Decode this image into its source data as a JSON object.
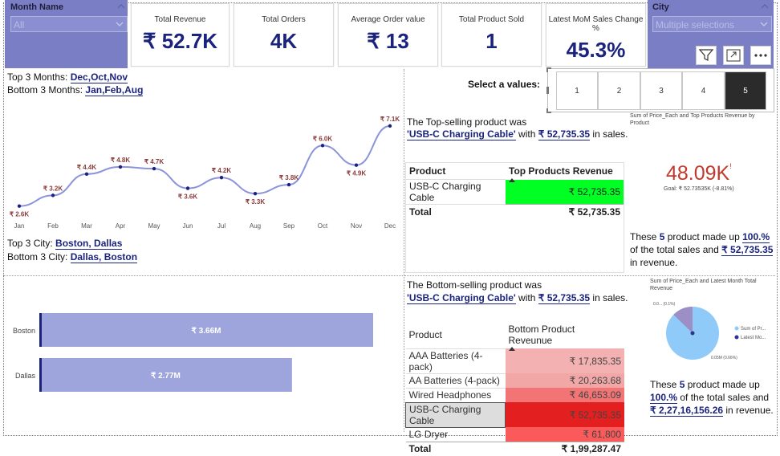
{
  "month_slicer": {
    "title": "Month Name",
    "value": "All"
  },
  "city_slicer": {
    "title": "City",
    "value": "Multiple selections"
  },
  "kpis": [
    {
      "label": "Total Revenue",
      "value": "₹ 52.7K"
    },
    {
      "label": "Total Orders",
      "value": "4K"
    },
    {
      "label": "Average Order value",
      "value": "₹ 13"
    },
    {
      "label": "Total Product Sold",
      "value": "1"
    },
    {
      "label": "Latest MoM Sales Change %",
      "value": "45.3%"
    }
  ],
  "months_text": {
    "top_prefix": "Top 3 Months: ",
    "top_value": "Dec,Oct,Nov",
    "bottom_prefix": "Bottom 3 Months: ",
    "bottom_value": "Jan,Feb,Aug"
  },
  "city_text": {
    "top_prefix": "Top 3 City:  ",
    "top_value": "Boston, Dallas",
    "bottom_prefix": "Bottom 3 City: ",
    "bottom_value": "Dallas, Boston"
  },
  "chart_data": [
    {
      "type": "line",
      "categories": [
        "Jan",
        "Feb",
        "Mar",
        "Apr",
        "May",
        "Jun",
        "Jul",
        "Aug",
        "Sep",
        "Oct",
        "Nov",
        "Dec"
      ],
      "values": [
        2.6,
        3.2,
        4.4,
        4.8,
        4.7,
        3.6,
        4.2,
        3.3,
        3.8,
        6.0,
        4.9,
        7.1
      ],
      "labels": [
        "₹ 2.6K",
        "₹ 3.2K",
        "₹ 4.4K",
        "₹ 4.8K",
        "₹ 4.7K",
        "₹ 3.6K",
        "₹ 4.2K",
        "₹ 3.3K",
        "₹ 3.8K",
        "₹ 6.0K",
        "₹ 4.9K",
        "₹ 7.1K"
      ],
      "color": "#8c93db"
    },
    {
      "type": "bar",
      "categories": [
        "Boston",
        "Dallas"
      ],
      "values": [
        3.66,
        2.77
      ],
      "labels": [
        "₹ 3.66M",
        "₹ 2.77M"
      ],
      "color": "#9ea4dc"
    },
    {
      "type": "pie",
      "title": "Sum of Price_Each and Latest Month Total Revenue",
      "legend": [
        "Sum of Pr...",
        "Latest Mo..."
      ],
      "slice_labels": [
        "0.05M (0.66%)",
        "0.0... (0.1%)"
      ],
      "colors": [
        "#90caf9",
        "#2c3592"
      ]
    }
  ],
  "select_values": {
    "label": "Select a values:",
    "options": [
      "1",
      "2",
      "3",
      "4",
      "5"
    ],
    "selected": "5"
  },
  "top_product_text": {
    "line1": "The Top-selling product  was",
    "product": "'USB-C Charging Cable'",
    "with": " with ",
    "amount": "₹ 52,735.35",
    "suffix": " in sales."
  },
  "top_table": {
    "col1": "Product",
    "col2": "Top Products Revenue",
    "rows": [
      {
        "product": "USB-C Charging Cable",
        "revenue": "₹ 52,735.35"
      }
    ],
    "total_label": "Total",
    "total_value": "₹ 52,735.35"
  },
  "gauge_card": {
    "title": "Sum of Price_Each and Top Products Revenue by Product",
    "value": "48.09K",
    "mark": "!",
    "goal": "Goal: ₹ 52.73535K (-8.81%)"
  },
  "top_summary": {
    "p1": "These ",
    "n": "5",
    "p2": " product made up ",
    "pct": "100.%",
    "p3": "of the total sales and ",
    "amount": "₹ 52,735.35",
    "p4": "in revenue."
  },
  "bottom_product_text": {
    "line1": "The Bottom-selling product  was",
    "product": "'USB-C Charging Cable'",
    "with": " with ",
    "amount": "₹ 52,735.35",
    "suffix": " in sales."
  },
  "bottom_table": {
    "col1": "Product",
    "col2": "Bottom Product Reveunue",
    "rows": [
      {
        "product": "AAA Batteries (4-pack)",
        "revenue": "₹ 17,835.35",
        "color": "#f4b1b1"
      },
      {
        "product": "AA Batteries (4-pack)",
        "revenue": "₹ 20,263.68",
        "color": "#f2a7a7"
      },
      {
        "product": "Wired Headphones",
        "revenue": "₹ 46,653.09",
        "color": "#f27474"
      },
      {
        "product": "USB-C Charging Cable",
        "revenue": "₹ 52,735.35",
        "color": "#e41f1f"
      },
      {
        "product": "LG Dryer",
        "revenue": "₹ 61,800",
        "color": "#fb5a5a"
      }
    ],
    "total_label": "Total",
    "total_value": "₹ 1,99,287.47"
  },
  "bottom_summary": {
    "p1": "These ",
    "n": "5",
    "p2": " product made up",
    "pct": "100.%",
    "p3": " of the total sales and",
    "amount": "₹ 2,27,16,156.26",
    "p4": " in revenue."
  },
  "icons": {
    "filter": "filter-icon",
    "focus": "focus-mode-icon",
    "more": "more-options-icon"
  }
}
